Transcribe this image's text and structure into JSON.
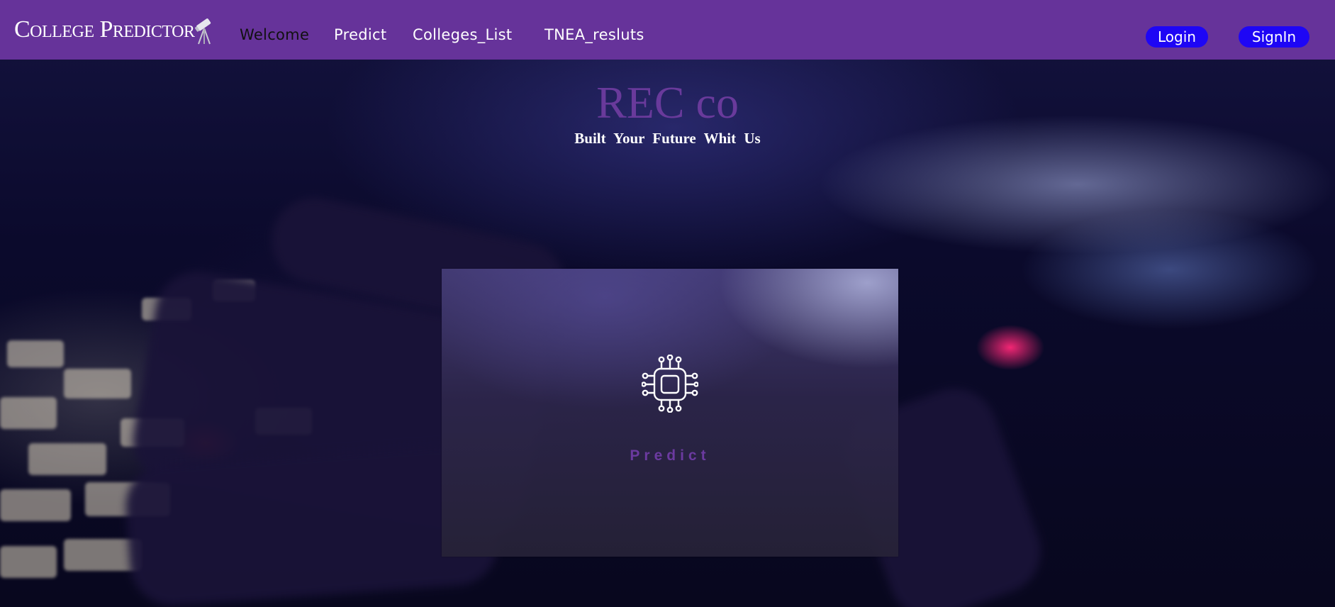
{
  "navbar": {
    "brand": "College Predictor",
    "brand_icon": "telescope-icon",
    "links": [
      {
        "label": "Welcome",
        "active": true
      },
      {
        "label": "Predict",
        "active": false
      },
      {
        "label": "Colleges_List",
        "active": false
      },
      {
        "label": "TNEA_resluts",
        "active": false
      }
    ],
    "login_label": "Login",
    "signin_label": "SignIn"
  },
  "hero": {
    "title": "REC co",
    "subtitle": "Built Your Future Whit Us"
  },
  "card": {
    "icon": "chip-circuit-icon",
    "label": "Predict"
  },
  "colors": {
    "navbar_bg": "#66339a",
    "accent_purple": "#693a9b",
    "button_blue": "#1e06f5"
  }
}
